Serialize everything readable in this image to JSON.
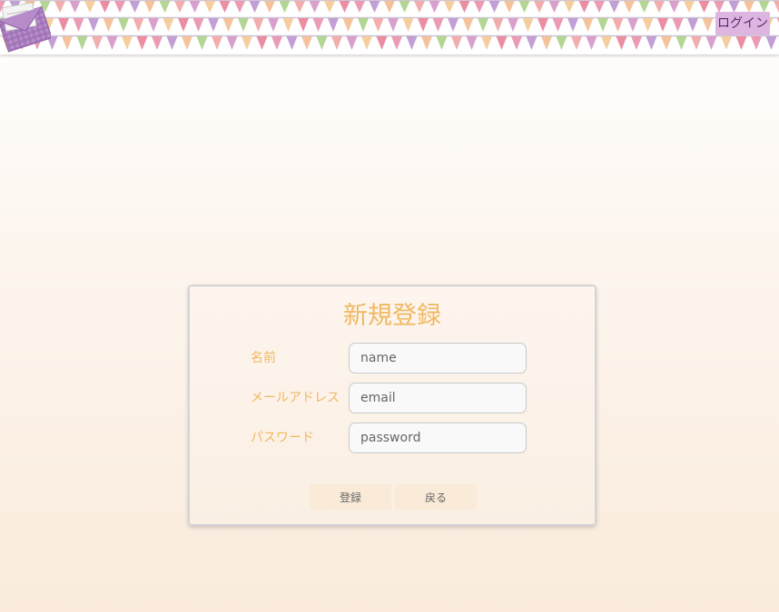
{
  "header": {
    "login_label": "ログイン"
  },
  "form": {
    "title": "新規登録",
    "fields": [
      {
        "label": "名前",
        "placeholder": "name"
      },
      {
        "label": "メールアドレス",
        "placeholder": "email"
      },
      {
        "label": "パスワード",
        "placeholder": "password"
      }
    ],
    "submit_label": "登録",
    "back_label": "戻る"
  },
  "icons": {
    "logo": "envelope-letter-icon",
    "decoration": "bunting-flags"
  },
  "colors": {
    "accent": "#f0b861",
    "login_bg": "#dcb6e0",
    "button_bg": "#faead8"
  }
}
